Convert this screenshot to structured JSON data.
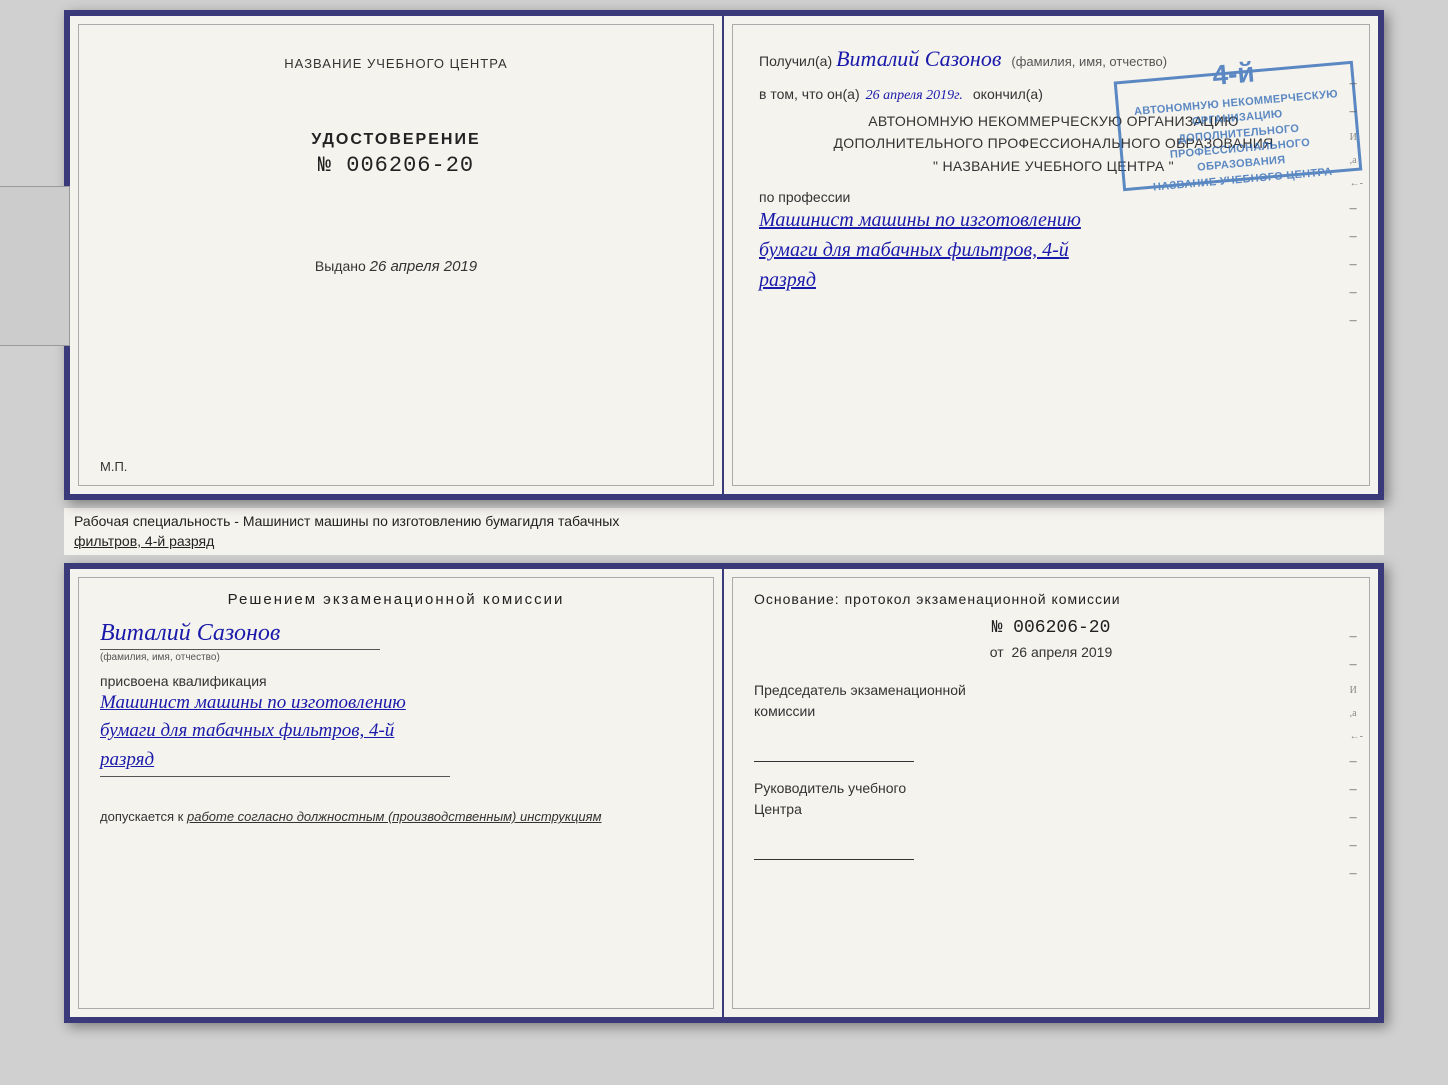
{
  "top_document": {
    "left_page": {
      "school_name_label": "НАЗВАНИЕ УЧЕБНОГО ЦЕНТРА",
      "certificate_title": "УДОСТОВЕРЕНИЕ",
      "certificate_number": "№ 006206-20",
      "issued_label": "Выдано",
      "issued_date": "26 апреля 2019",
      "mp_label": "М.П."
    },
    "right_page": {
      "received_label": "Получил(а)",
      "recipient_name": "Виталий Сазонов",
      "name_subtitle": "(фамилия, имя, отчество)",
      "vtom_prefix": "в том, что он(а)",
      "vtom_date": "26 апреля 2019г.",
      "okончil_label": "окончил(а)",
      "org_line1": "АВТОНОМНУЮ НЕКОММЕРЧЕСКУЮ ОРГАНИЗАЦИЮ",
      "org_line2": "ДОПОЛНИТЕЛЬНОГО ПРОФЕССИОНАЛЬНОГО ОБРАЗОВАНИЯ",
      "org_line3": "\" НАЗВАНИЕ УЧЕБНОГО ЦЕНТРА \"",
      "profession_label": "по профессии",
      "profession_line1": "Машинист машины по изготовлению",
      "profession_line2": "бумаги для табачных фильтров, 4-й",
      "profession_line3": "разряд",
      "stamp_number": "4-й",
      "stamp_line1": "АВТОНОМНУЮ НЕКОММЕРЧЕСКУЮ ОРГАНИЗАЦИЮ",
      "stamp_line2": "ДОПОЛНИТЕЛЬНОГО ПРОФЕССИОНАЛЬНОГО ОБРАЗОВАНИЯ",
      "stamp_line3": "НАЗВАНИЕ УЧЕБНОГО ЦЕНТРА"
    }
  },
  "between_label": {
    "text_line1": "Рабочая специальность - Машинист машины по изготовлению бумагидля табачных",
    "text_line2": "фильтров, 4-й разряд"
  },
  "bottom_document": {
    "left_page": {
      "decision_title": "Решением  экзаменационной  комиссии",
      "person_name": "Виталий Сазонов",
      "name_subtitle": "(фамилия, имя, отчество)",
      "qualification_label": "присвоена квалификация",
      "qualification_line1": "Машинист машины по изготовлению",
      "qualification_line2": "бумаги для табачных фильтров, 4-й",
      "qualification_line3": "разряд",
      "work_permission_prefix": "допускается к",
      "work_permission_text": "работе согласно должностным (производственным) инструкциям"
    },
    "right_page": {
      "basis_label": "Основание: протокол экзаменационной  комиссии",
      "protocol_number": "№  006206-20",
      "date_prefix": "от",
      "date_value": "26 апреля 2019",
      "chairman_title_line1": "Председатель экзаменационной",
      "chairman_title_line2": "комиссии",
      "head_title_line1": "Руководитель учебного",
      "head_title_line2": "Центра"
    }
  }
}
